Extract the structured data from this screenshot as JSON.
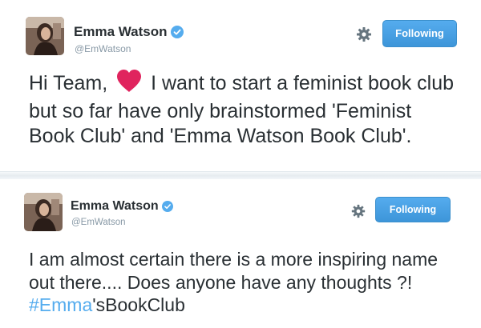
{
  "tweets": [
    {
      "author": {
        "name": "Emma Watson",
        "handle": "@EmWatson",
        "verified": true,
        "avatar": "avatar-photo"
      },
      "follow_label": "Following",
      "icons": {
        "settings": "gear-icon",
        "verified": "verified-badge-icon",
        "emoji": "red-heart-emoji"
      },
      "text": {
        "part1": "Hi Team,",
        "part2": "I want to start a feminist book club but so far have only brainstormed 'Feminist Book Club' and 'Emma Watson Book Club'."
      }
    },
    {
      "author": {
        "name": "Emma Watson",
        "handle": "@EmWatson",
        "verified": true,
        "avatar": "avatar-photo"
      },
      "follow_label": "Following",
      "icons": {
        "settings": "gear-icon",
        "verified": "verified-badge-icon"
      },
      "text": {
        "part1": "I am almost certain there is a more inspiring name out there.... Does anyone have any thoughts ?!",
        "hashtag": "#Emma",
        "part2": "'sBookClub"
      }
    }
  ],
  "colors": {
    "accent": "#55acee",
    "text": "#292f33",
    "muted": "#8899a6",
    "heart": "#e0245e",
    "separator": "#e6ecf0"
  }
}
